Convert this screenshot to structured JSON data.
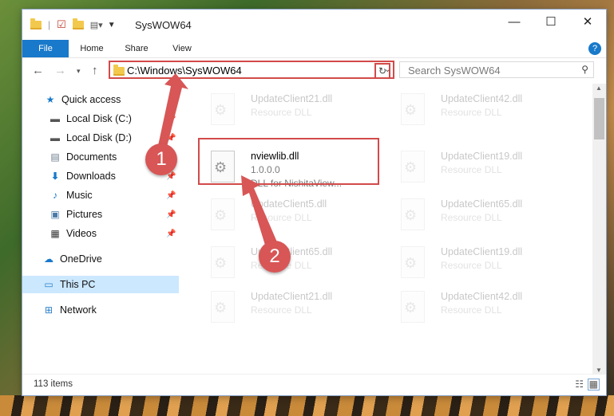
{
  "window": {
    "title": "SysWOW64",
    "controls": {
      "minimize": "—",
      "maximize": "☐",
      "close": "✕"
    }
  },
  "ribbon": {
    "tabs": [
      "File",
      "Home",
      "Share",
      "View"
    ],
    "help": "?"
  },
  "nav": {
    "address": "C:\\Windows\\SysWOW64",
    "search_placeholder": "Search SysWOW64"
  },
  "sidebar": {
    "items": [
      {
        "label": "Quick access",
        "icon": "star-icon"
      },
      {
        "label": "Local Disk (C:)",
        "icon": "drive-icon"
      },
      {
        "label": "Local Disk (D:)",
        "icon": "drive-icon"
      },
      {
        "label": "Documents",
        "icon": "documents-icon"
      },
      {
        "label": "Downloads",
        "icon": "download-icon"
      },
      {
        "label": "Music",
        "icon": "music-icon"
      },
      {
        "label": "Pictures",
        "icon": "pictures-icon"
      },
      {
        "label": "Videos",
        "icon": "video-icon"
      },
      {
        "label": "OneDrive",
        "icon": "cloud-icon"
      },
      {
        "label": "This PC",
        "icon": "computer-icon"
      },
      {
        "label": "Network",
        "icon": "network-icon"
      }
    ]
  },
  "files": [
    {
      "name": "UpdateClient21.dll",
      "line2": "Resource DLL",
      "line3": ""
    },
    {
      "name": "UpdateClient42.dll",
      "line2": "Resource DLL",
      "line3": ""
    },
    {
      "name": "nviewlib.dll",
      "line2": "1.0.0.0",
      "line3": "DLL for NishitaView..."
    },
    {
      "name": "UpdateClient19.dll",
      "line2": "Resource DLL",
      "line3": ""
    },
    {
      "name": "UpdateClient5.dll",
      "line2": "Resource DLL",
      "line3": ""
    },
    {
      "name": "UpdateClient65.dll",
      "line2": "Resource DLL",
      "line3": ""
    },
    {
      "name": "UpdateClient65.dll",
      "line2": "Resource DLL",
      "line3": ""
    },
    {
      "name": "UpdateClient19.dll",
      "line2": "Resource DLL",
      "line3": ""
    },
    {
      "name": "UpdateClient21.dll",
      "line2": "Resource DLL",
      "line3": ""
    },
    {
      "name": "UpdateClient42.dll",
      "line2": "Resource DLL",
      "line3": ""
    }
  ],
  "status": {
    "item_count": "113 items"
  },
  "annotations": {
    "badge1": "1",
    "badge2": "2",
    "color": "#d85656"
  }
}
